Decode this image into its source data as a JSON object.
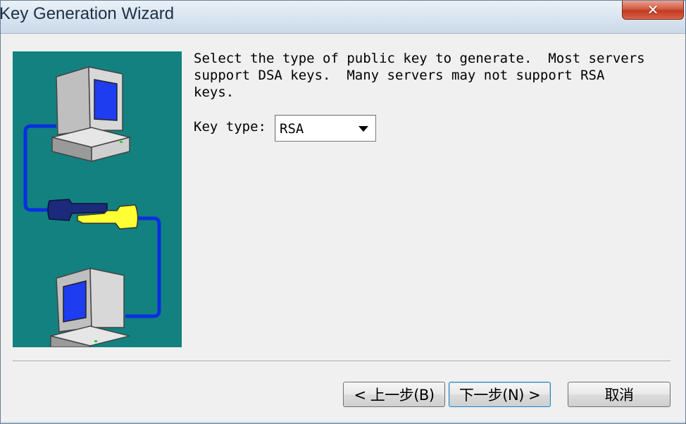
{
  "window": {
    "title": "Key Generation Wizard",
    "close_symbol": "✕"
  },
  "illustration": {
    "icons": [
      "computer-icon",
      "key-icon",
      "computer-icon"
    ],
    "colors": {
      "background": "#138180",
      "cable": "#0a2fe0",
      "screen": "#1e3cf0",
      "key_dark": "#1b2a7a",
      "key_light": "#ffff33"
    }
  },
  "main": {
    "description": "Select the type of public key to generate.  Most servers\nsupport DSA keys.  Many servers may not support RSA\nkeys.",
    "key_type_label": "Key type:",
    "key_type_value": "RSA"
  },
  "buttons": {
    "back": "< 上一步(B)",
    "next": "下一步(N) >",
    "cancel": "取消"
  }
}
